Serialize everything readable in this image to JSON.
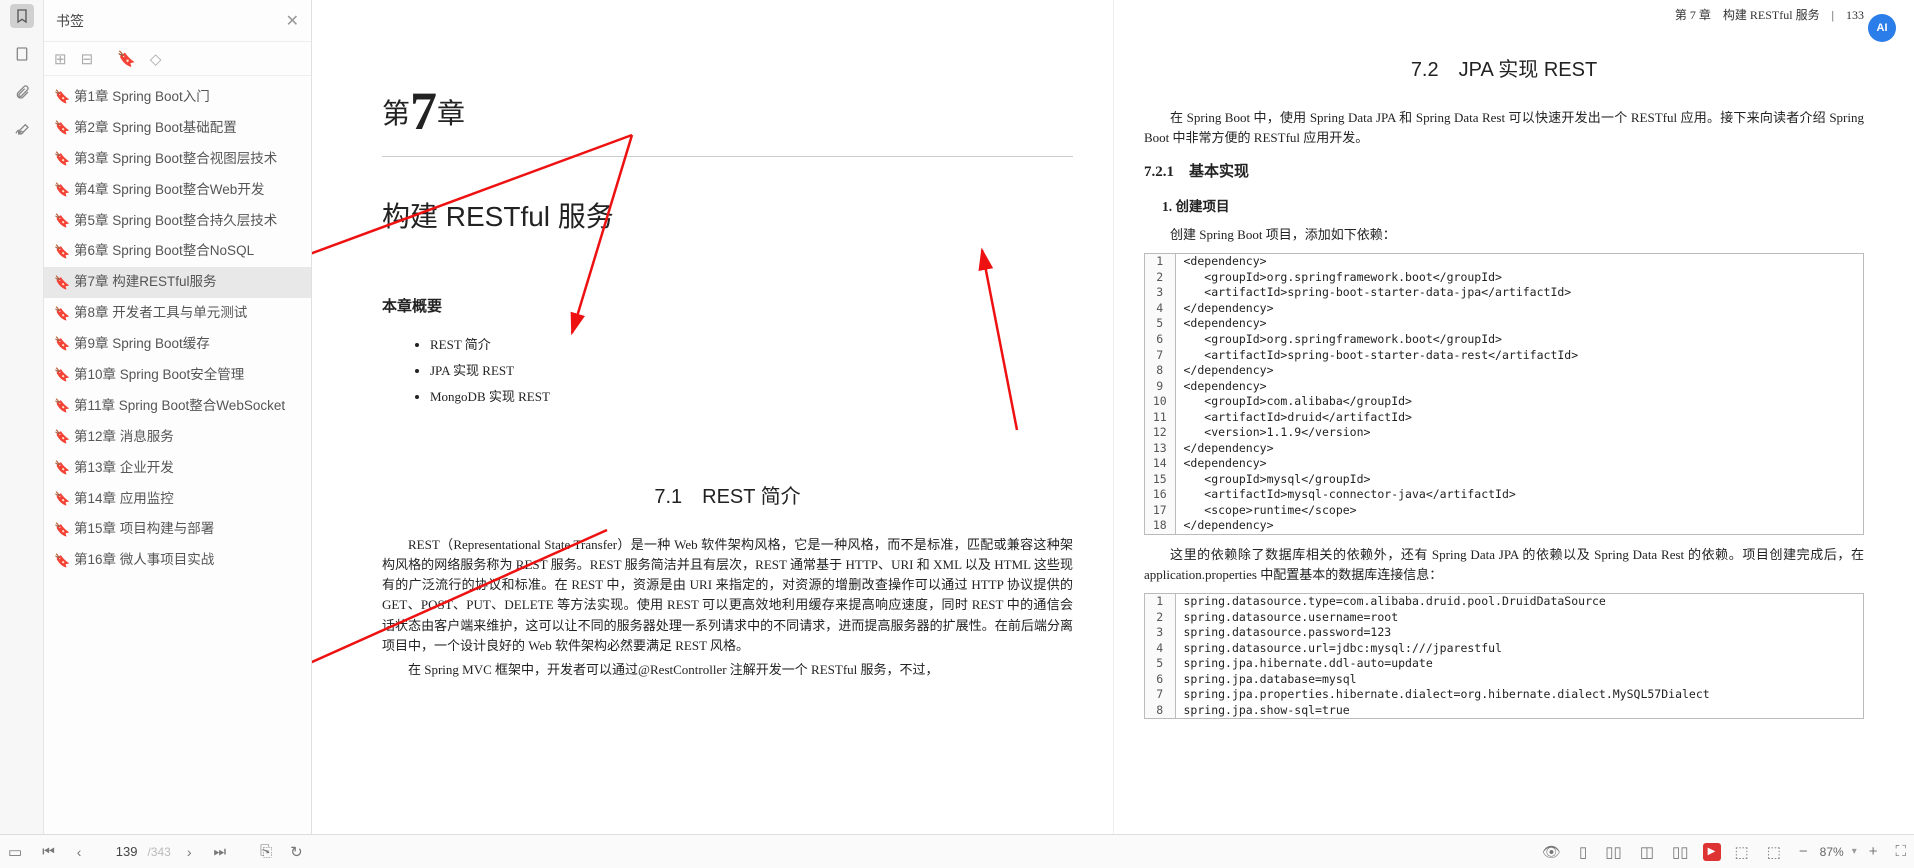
{
  "sidebar": {
    "title": "书签",
    "items": [
      {
        "label": "第1章 Spring Boot入门"
      },
      {
        "label": "第2章 Spring Boot基础配置"
      },
      {
        "label": "第3章 Spring Boot整合视图层技术"
      },
      {
        "label": "第4章 Spring Boot整合Web开发"
      },
      {
        "label": "第5章 Spring Boot整合持久层技术"
      },
      {
        "label": "第6章 Spring Boot整合NoSQL"
      },
      {
        "label": "第7章 构建RESTful服务",
        "selected": true
      },
      {
        "label": "第8章 开发者工具与单元测试"
      },
      {
        "label": "第9章 Spring Boot缓存"
      },
      {
        "label": "第10章 Spring Boot安全管理"
      },
      {
        "label": "第11章 Spring Boot整合WebSocket"
      },
      {
        "label": "第12章 消息服务"
      },
      {
        "label": "第13章 企业开发"
      },
      {
        "label": "第14章 应用监控"
      },
      {
        "label": "第15章 项目构建与部署"
      },
      {
        "label": "第16章 微人事项目实战"
      }
    ]
  },
  "left_page": {
    "chapter_prefix": "第",
    "chapter_number": "7",
    "chapter_suffix": "章",
    "chapter_title": "构建 RESTful 服务",
    "overview_title": "本章概要",
    "bullets": [
      "REST 简介",
      "JPA 实现 REST",
      "MongoDB 实现 REST"
    ],
    "h1": "7.1　REST 简介",
    "paras": [
      "REST（Representational State Transfer）是一种 Web 软件架构风格，它是一种风格，而不是标准，匹配或兼容这种架构风格的网络服务称为 REST 服务。REST 服务简洁并且有层次，REST 通常基于 HTTP、URI 和 XML 以及 HTML 这些现有的广泛流行的协议和标准。在 REST 中，资源是由 URI 来指定的，对资源的增删改查操作可以通过 HTTP 协议提供的 GET、POST、PUT、DELETE 等方法实现。使用 REST 可以更高效地利用缓存来提高响应速度，同时 REST 中的通信会话状态由客户端来维护，这可以让不同的服务器处理一系列请求中的不同请求，进而提高服务器的扩展性。在前后端分离项目中，一个设计良好的 Web 软件架构必然要满足 REST 风格。",
      "在 Spring MVC 框架中，开发者可以通过@RestController 注解开发一个 RESTful 服务，不过，"
    ]
  },
  "right_page": {
    "running_head": "第 7 章　构建 RESTful 服务　|　133",
    "h1": "7.2　JPA 实现 REST",
    "intro": "在 Spring Boot 中，使用 Spring Data JPA 和 Spring Data Rest 可以快速开发出一个 RESTful 应用。接下来向读者介绍 Spring Boot 中非常方便的 RESTful 应用开发。",
    "h2": "7.2.1　基本实现",
    "h3": "1. 创建项目",
    "p1": "创建 Spring Boot 项目，添加如下依赖：",
    "code1": [
      "<dependency>",
      "   <groupId>org.springframework.boot</groupId>",
      "   <artifactId>spring-boot-starter-data-jpa</artifactId>",
      "</dependency>",
      "<dependency>",
      "   <groupId>org.springframework.boot</groupId>",
      "   <artifactId>spring-boot-starter-data-rest</artifactId>",
      "</dependency>",
      "<dependency>",
      "   <groupId>com.alibaba</groupId>",
      "   <artifactId>druid</artifactId>",
      "   <version>1.1.9</version>",
      "</dependency>",
      "<dependency>",
      "   <groupId>mysql</groupId>",
      "   <artifactId>mysql-connector-java</artifactId>",
      "   <scope>runtime</scope>",
      "</dependency>"
    ],
    "p2": "这里的依赖除了数据库相关的依赖外，还有 Spring Data JPA 的依赖以及 Spring Data Rest 的依赖。项目创建完成后，在 application.properties 中配置基本的数据库连接信息：",
    "code2": [
      "spring.datasource.type=com.alibaba.druid.pool.DruidDataSource",
      "spring.datasource.username=root",
      "spring.datasource.password=123",
      "spring.datasource.url=jdbc:mysql:///jparestful",
      "spring.jpa.hibernate.ddl-auto=update",
      "spring.jpa.database=mysql",
      "spring.jpa.properties.hibernate.dialect=org.hibernate.dialect.MySQL57Dialect",
      "spring.jpa.show-sql=true"
    ]
  },
  "status": {
    "page_current": "139",
    "page_total": "/343",
    "zoom": "87%"
  },
  "ai_label": "AI"
}
